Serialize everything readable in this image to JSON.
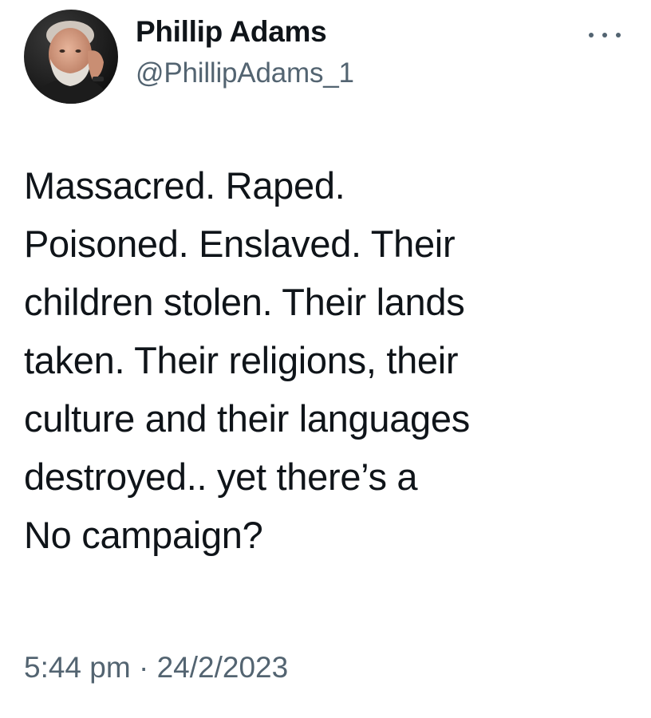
{
  "tweet": {
    "author": {
      "display_name": "Phillip Adams",
      "handle": "@PhillipAdams_1",
      "avatar_icon": "profile-photo-bearded-man"
    },
    "more_icon": "ellipsis-icon",
    "text_lines": [
      "Massacred. Raped.",
      "Poisoned. Enslaved. Their",
      "children stolen. Their lands",
      "taken. Their religions, their",
      "culture and their languages",
      "destroyed.. yet there’s a",
      "No campaign?"
    ],
    "time": "5:44 pm",
    "separator": "·",
    "date": "24/2/2023"
  },
  "colors": {
    "text_primary": "#0f1419",
    "text_secondary": "#536471",
    "background": "#ffffff"
  }
}
